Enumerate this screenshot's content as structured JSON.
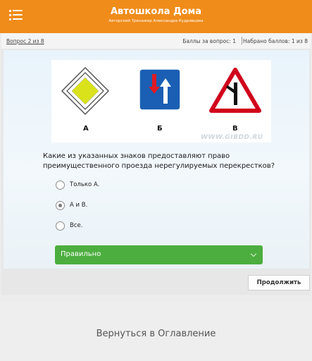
{
  "header": {
    "title": "Автошкола Дома",
    "subtitle": "Авторский Тренажер Александра Кудрявцева"
  },
  "info": {
    "question_number": "Вопрос 2 из 8",
    "points_per_question": "Баллы за вопрос: 1",
    "points_total": "Набрано баллов: 1 из 8"
  },
  "image": {
    "labels": [
      "А",
      "Б",
      "В"
    ],
    "watermark": "WWW.GIBDD.RU"
  },
  "question": "Какие из указанных знаков предоставляют право преимущественного проезда нерегулируемых перекрестков?",
  "options": [
    {
      "label": "Только А.",
      "checked": false
    },
    {
      "label": "А и В.",
      "checked": true
    },
    {
      "label": "Все.",
      "checked": false
    }
  ],
  "result": {
    "text": "Правильно",
    "color": "#4cae3f"
  },
  "continue_label": "Продолжить",
  "back_link": "Вернуться в Оглавление",
  "colors": {
    "accent": "#f08c1a"
  }
}
